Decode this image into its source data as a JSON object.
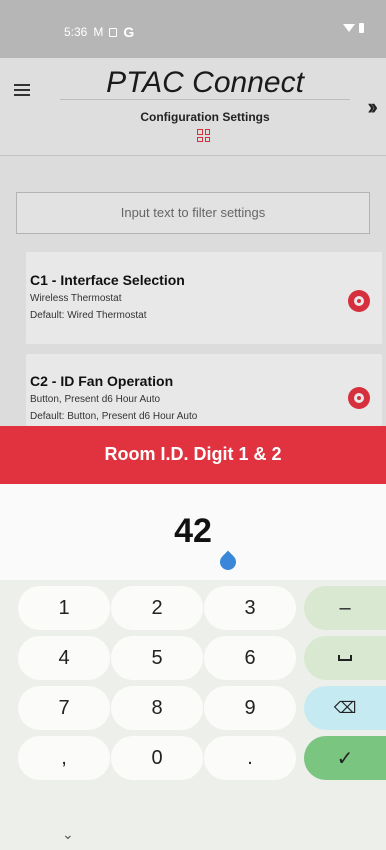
{
  "status_bar": {
    "time": "5:36",
    "mail_glyph": "M",
    "carrier_glyph": "G"
  },
  "header": {
    "app_title": "PTAC Connect",
    "page_title": "Configuration Settings",
    "menu_icon": "hamburger-menu-icon",
    "grid_icon": "grid-icon",
    "forward_icon": "double-chevron-right-icon"
  },
  "filter": {
    "placeholder": "Input text to filter settings"
  },
  "settings": [
    {
      "title": "C1 - Interface Selection",
      "value": "Wireless Thermostat",
      "default": "Default: Wired Thermostat",
      "icon": "gear-icon"
    },
    {
      "title": "C2 - ID Fan Operation",
      "value": "Button, Present d6 Hour Auto",
      "default": "Default: Button, Present d6 Hour Auto",
      "icon": "gear-icon"
    }
  ],
  "dialog": {
    "title": "Room I.D. Digit 1 & 2",
    "value": "42"
  },
  "keyboard": {
    "keys": [
      "1",
      "2",
      "3",
      "–",
      "4",
      "5",
      "6",
      "7",
      "8",
      "9",
      ",",
      "0",
      "."
    ],
    "backspace_glyph": "⌫",
    "done_glyph": "✓",
    "collapse_glyph": "⌄"
  },
  "colors": {
    "accent_red": "#e0323f",
    "cursor_blue": "#3a86d8",
    "done_green": "#7ac57f"
  }
}
